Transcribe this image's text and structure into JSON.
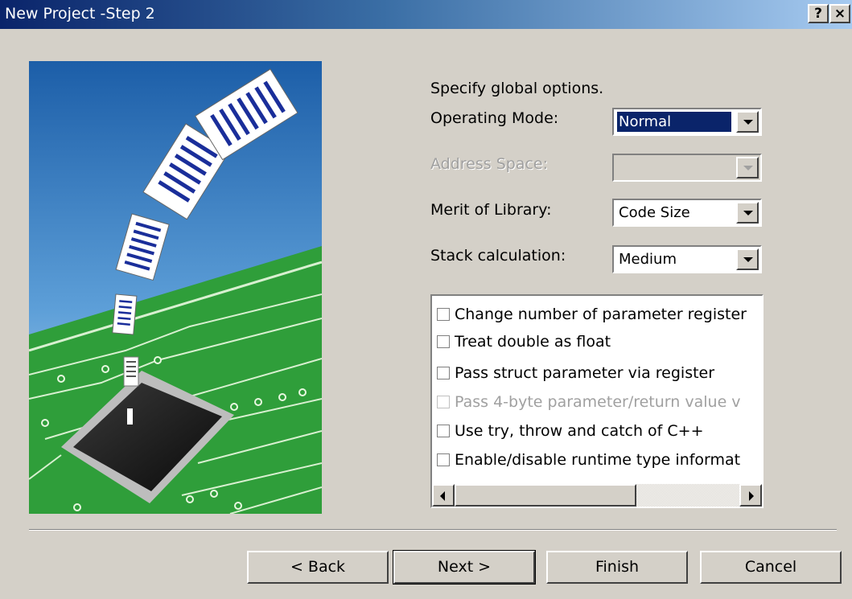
{
  "window": {
    "title": "New Project -Step 2",
    "help_button": "?",
    "close_button": "×"
  },
  "options": {
    "heading": "Specify global options.",
    "operating_mode": {
      "label": "Operating Mode:",
      "value": "Normal"
    },
    "address_space": {
      "label": "Address Space:",
      "value": "",
      "enabled": false
    },
    "merit_of_library": {
      "label": "Merit of Library:",
      "value": "Code Size"
    },
    "stack_calculation": {
      "label": "Stack calculation:",
      "value": "Medium"
    }
  },
  "checklist": {
    "items": [
      {
        "label": "Change number of parameter register",
        "checked": false,
        "enabled": true
      },
      {
        "label": "Treat double as float",
        "checked": false,
        "enabled": true
      },
      {
        "label": "Pass struct parameter via register",
        "checked": false,
        "enabled": true
      },
      {
        "label": "Pass 4-byte parameter/return value v",
        "checked": false,
        "enabled": false
      },
      {
        "label": "Use try, throw and catch of C++",
        "checked": false,
        "enabled": true
      },
      {
        "label": "Enable/disable runtime type informat",
        "checked": false,
        "enabled": true
      }
    ]
  },
  "buttons": {
    "back": "< Back",
    "next": "Next >",
    "finish": "Finish",
    "cancel": "Cancel"
  },
  "colors": {
    "titlebar_start": "#0a246a",
    "titlebar_end": "#a6caf0",
    "dialog_face": "#d4d0c8",
    "selection": "#0a246a",
    "art_sky_top": "#1c5ea8",
    "art_board": "#2f9e3a"
  }
}
